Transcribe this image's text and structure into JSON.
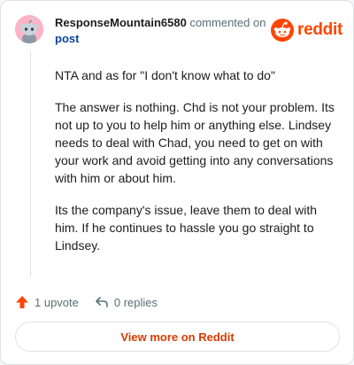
{
  "comment": {
    "author": "ResponseMountain6580",
    "action_text": "commented on",
    "target_link": "post",
    "paragraphs": [
      "NTA and as for \"I don't know what to do\"",
      "The answer is nothing. Chd is not your problem. Its not up to you to help him or anything else. Lindsey needs to deal with Chad, you need to get on with your work and avoid getting into any conversations with him or about him.",
      "Its the company's issue, leave them to deal with him. If he continues to hassle you go straight to Lindsey."
    ]
  },
  "brand": {
    "name": "reddit",
    "icon": "reddit-logo-icon",
    "color": "#ff4500"
  },
  "actions": {
    "upvote_label": "1 upvote",
    "replies_label": "0 replies",
    "upvote_icon": "upvote-arrow-icon",
    "reply_icon": "reply-arrow-icon",
    "upvote_color": "#ff4500"
  },
  "view_more": {
    "label": "View more on Reddit",
    "color": "#d93a00"
  }
}
